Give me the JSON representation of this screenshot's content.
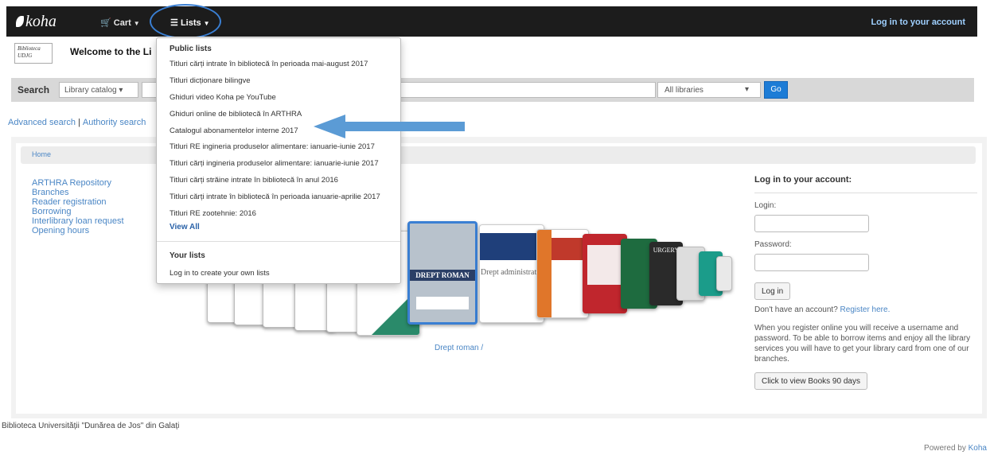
{
  "navbar": {
    "logo": "koha",
    "cart_label": "Cart",
    "lists_label": "Lists",
    "login_link": "Log in to your account"
  },
  "header": {
    "logo_text": "Biblioteca UDJG",
    "welcome": "Welcome to the Li"
  },
  "search": {
    "label": "Search",
    "catalog_select": "Library catalog",
    "query": "",
    "library_select": "All libraries",
    "go_label": "Go"
  },
  "links": {
    "advanced": "Advanced search",
    "authority": "Authority search"
  },
  "breadcrumb": {
    "home": "Home"
  },
  "sidebar": {
    "items": [
      {
        "label": "ARTHRA Repository"
      },
      {
        "label": "Branches"
      },
      {
        "label": "Reader registration"
      },
      {
        "label": "Borrowing"
      },
      {
        "label": "Interlibrary loan request"
      },
      {
        "label": "Opening hours"
      }
    ]
  },
  "carousel": {
    "focused_title": "Drept roman /",
    "cover_texts": [
      "DREPT ROMAN",
      "Drept administrativ",
      "URGERY"
    ]
  },
  "login": {
    "heading": "Log in to your account:",
    "login_label": "Login:",
    "password_label": "Password:",
    "button": "Log in",
    "no_account": "Don't have an account?",
    "register": "Register here.",
    "help_text": "When you register online you will receive a username and password. To be able to borrow items and enjoy all the library services you will have to get your library card from one of our branches.",
    "books90": "Click to view Books 90 days"
  },
  "footer": {
    "library_name": "Biblioteca Universității \"Dunărea de Jos\" din Galați",
    "powered_by": "Powered by",
    "koha": "Koha"
  },
  "lists_menu": {
    "public_header": "Public lists",
    "public_lists": [
      "Titluri cărți intrate în bibliotecă în perioada mai-august 2017",
      "Titluri dicționare bilingve",
      "Ghiduri video Koha pe YouTube",
      "Ghiduri online de bibliotecă în ARTHRA",
      "Catalogul abonamentelor interne 2017",
      "Titluri RE ingineria produselor alimentare: ianuarie-iunie 2017",
      "Titluri cărți ingineria produselor alimentare: ianuarie-iunie 2017",
      "Titluri cărți străine intrate în bibliotecă în anul 2016",
      "Titluri cărți intrate în bibliotecă în perioada ianuarie-aprilie 2017",
      "Titluri RE zootehnie: 2016"
    ],
    "view_all": "View All",
    "your_lists_header": "Your lists",
    "login_prompt": "Log in to create your own lists"
  },
  "colors": {
    "navbar": "#1c1c1c",
    "link": "#4a86c5",
    "go_button": "#1d7cd6",
    "annotation": "#5b9bd5"
  }
}
